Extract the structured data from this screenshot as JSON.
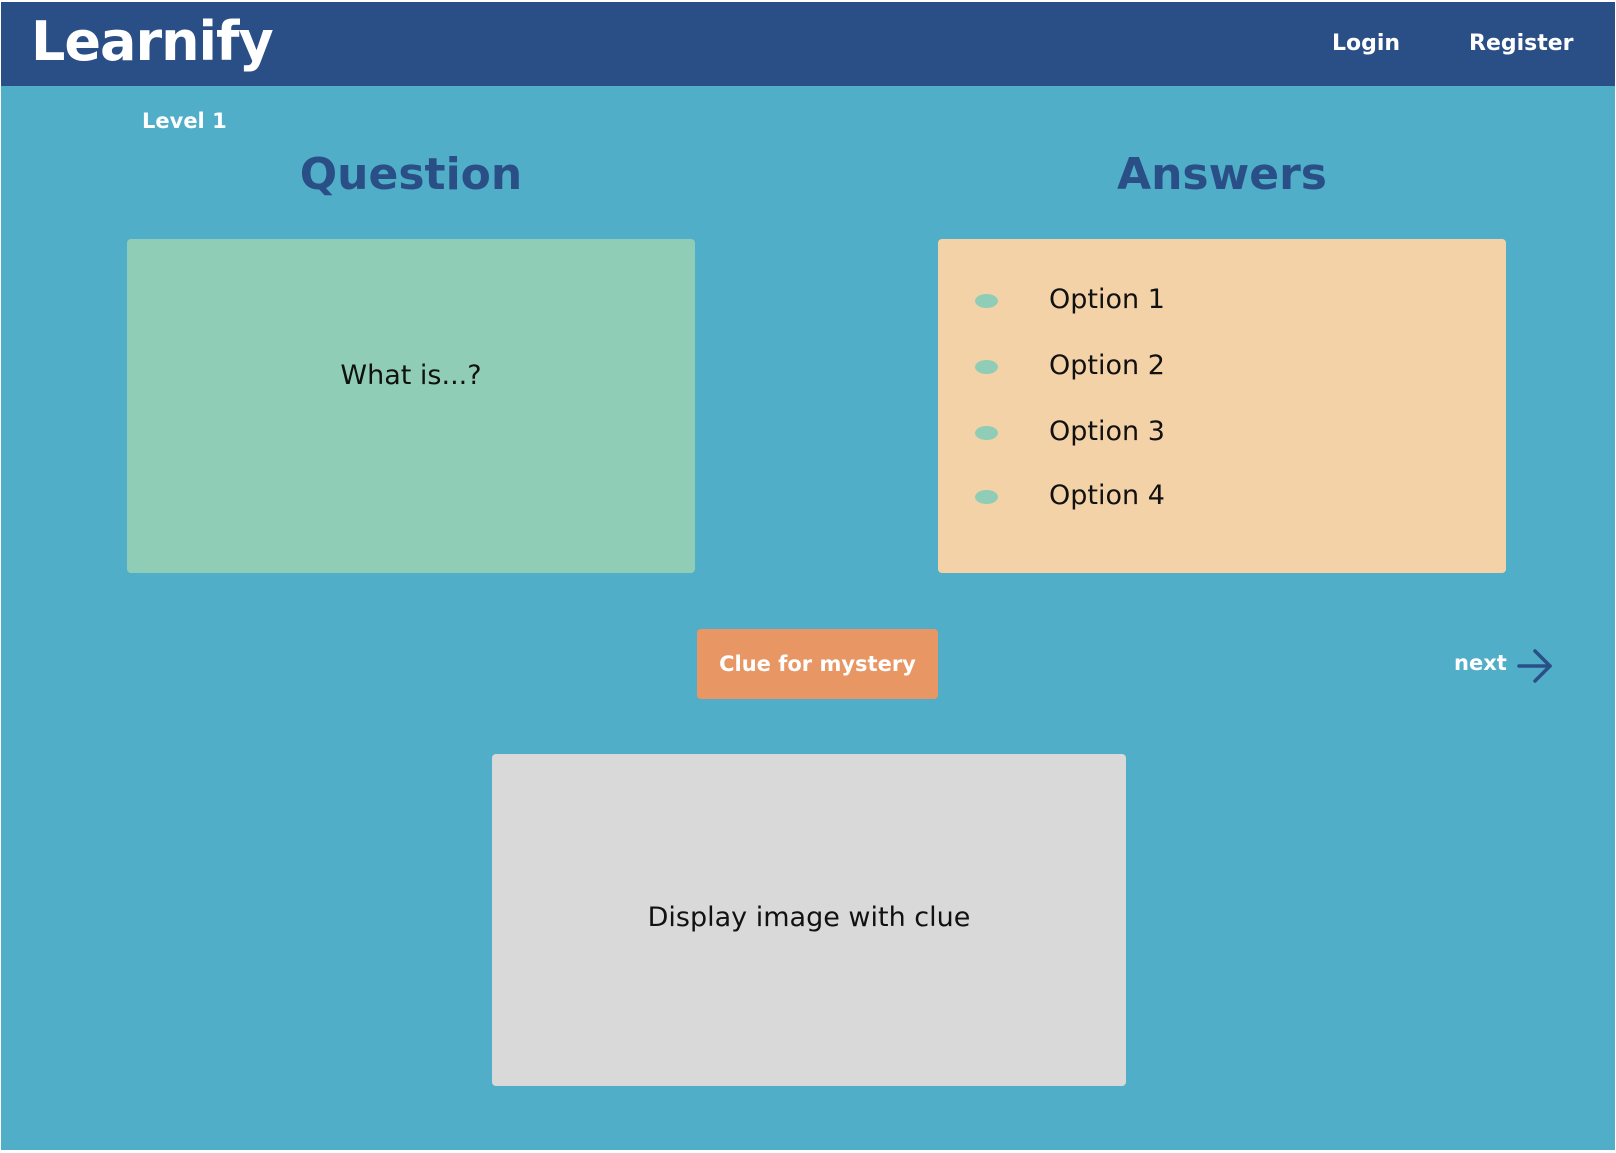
{
  "header": {
    "logo": "Learnify",
    "nav": {
      "login": "Login",
      "register": "Register"
    }
  },
  "level": "Level 1",
  "question": {
    "heading": "Question",
    "text": "What is...?"
  },
  "answers": {
    "heading": "Answers",
    "options": [
      "Option 1",
      "Option 2",
      "Option 3",
      "Option 4"
    ]
  },
  "clue_button": "Clue for mystery",
  "next": {
    "label": "next",
    "icon": "arrow-right-icon"
  },
  "clue_image": {
    "text": "Display image with clue"
  },
  "colors": {
    "header": "#2a4f86",
    "background": "#50aec8",
    "question_card": "#8fcdb6",
    "answers_card": "#f4d2a7",
    "clue_button": "#e89664",
    "image_placeholder": "#d9d9d9",
    "heading_text": "#2a4f86"
  }
}
